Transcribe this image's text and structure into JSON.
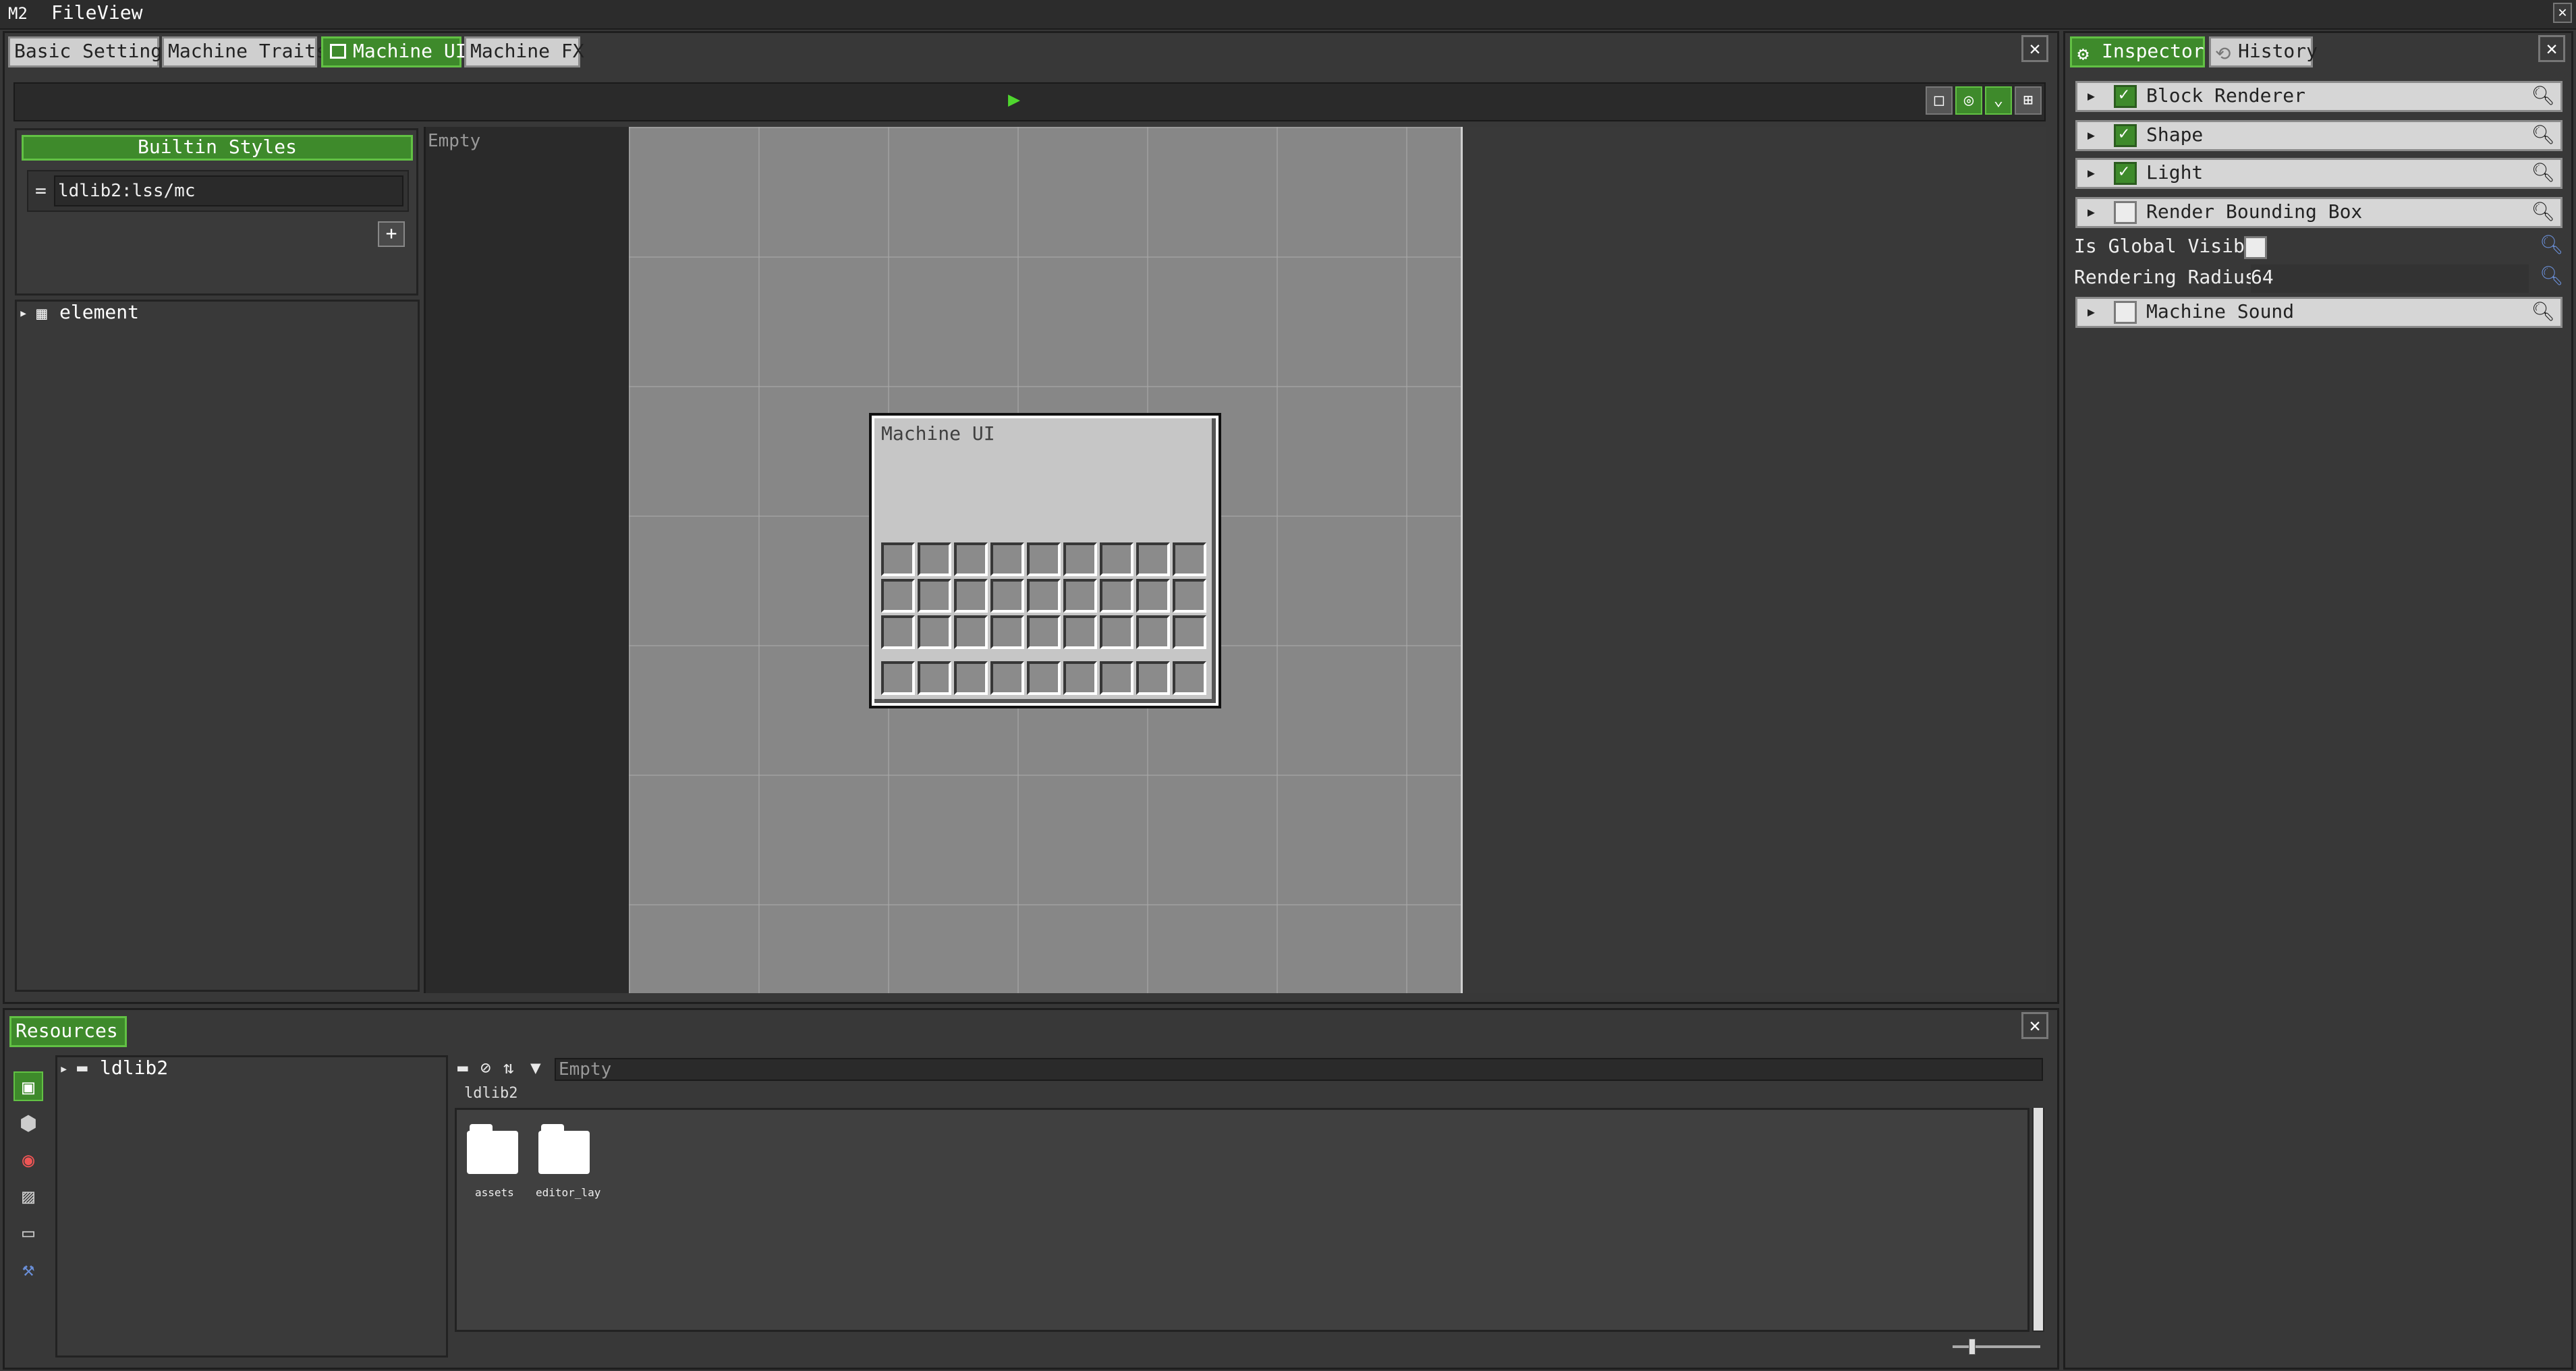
{
  "menu": {
    "logo": "M2",
    "items": [
      "File",
      "View"
    ],
    "close": "✕"
  },
  "tabs": [
    "Basic Settings",
    "Machine Traits",
    "Machine UI",
    "Machine FX"
  ],
  "active_tab_icon": "window-icon",
  "toolbar": {
    "play": "▶",
    "buttons": [
      "□",
      "◎",
      "⌄",
      "⊞"
    ]
  },
  "styles": {
    "header": "Builtin Styles",
    "entry_handle": "=",
    "entry_value": "ldlib2:lss/mc",
    "add": "+"
  },
  "tree": {
    "item_label": "element"
  },
  "middle_list": {
    "empty_text": "Empty"
  },
  "machine_ui": {
    "title": "Machine UI",
    "grid": {
      "cols": 9,
      "rows_main": 3,
      "rows_hotbar": 1
    }
  },
  "inspector": {
    "tabs": [
      "Inspector",
      "History"
    ],
    "components": [
      {
        "label": "Block Renderer",
        "checked": true
      },
      {
        "label": "Shape",
        "checked": true
      },
      {
        "label": "Light",
        "checked": true
      },
      {
        "label": "Render Bounding Box",
        "checked": false
      }
    ],
    "props": {
      "global_visible_label": "Is Global Visible",
      "radius_label": "Rendering Radius",
      "radius_value": "64"
    },
    "extra_component": {
      "label": "Machine Sound",
      "checked": false
    }
  },
  "resources": {
    "tab": "Resources",
    "tree_root": "ldlib2",
    "filter_placeholder": "Empty",
    "path": "ldlib2",
    "folders": [
      "assets",
      "editor_lay"
    ]
  },
  "colors": {
    "accent": "#3e8a2b",
    "background": "#373737"
  }
}
